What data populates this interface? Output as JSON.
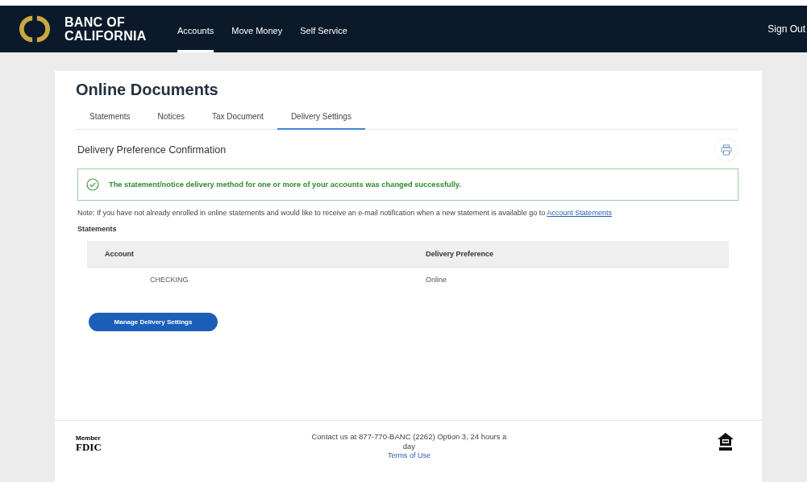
{
  "header": {
    "logo_text": "BANC OF CALIFORNIA",
    "nav": [
      {
        "label": "Accounts",
        "selected": true
      },
      {
        "label": "Move Money",
        "selected": false
      },
      {
        "label": "Self Service",
        "selected": false
      }
    ],
    "sign_out": "Sign Out"
  },
  "page": {
    "title": "Online Documents",
    "tabs": [
      {
        "label": "Statements",
        "selected": false
      },
      {
        "label": "Notices",
        "selected": false
      },
      {
        "label": "Tax Document",
        "selected": false
      },
      {
        "label": "Delivery Settings",
        "selected": true
      }
    ],
    "section_title": "Delivery Preference Confirmation",
    "success_message": "The statement/notice delivery method for one or more of your accounts was changed successfully.",
    "note": "Note: If you have not already enrolled in online statements and would like to receive an e-mail notification when a new statement is available go to",
    "note_link": "Account Statements",
    "table_title": "Statements",
    "table": {
      "columns": [
        "Account",
        "Delivery Preference"
      ],
      "rows": [
        [
          "CHECKING",
          "Online"
        ]
      ]
    },
    "button": "Manage Delivery Settings"
  },
  "footer": {
    "fdic_member": "Member",
    "fdic": "FDIC",
    "contact": "Contact us at 877-770-BANC (2262) Option 3, 24 hours a day",
    "terms": "Terms of Use"
  }
}
